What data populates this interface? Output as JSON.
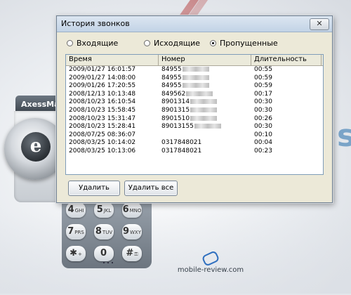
{
  "window": {
    "title": "История звонков",
    "close_label": "✕"
  },
  "filters": [
    {
      "label": "Входящие",
      "checked": false
    },
    {
      "label": "Исходящие",
      "checked": false
    },
    {
      "label": "Пропущенные",
      "checked": true
    }
  ],
  "table": {
    "headers": [
      "Время",
      "Номер",
      "Длительность"
    ],
    "rows": [
      {
        "time": "2009/01/27 16:01:57",
        "number": "84955",
        "masked": true,
        "duration": "00:55"
      },
      {
        "time": "2009/01/27 14:08:00",
        "number": "84955",
        "masked": true,
        "duration": "00:59"
      },
      {
        "time": "2009/01/26 17:20:55",
        "number": "84955",
        "masked": true,
        "duration": "00:59"
      },
      {
        "time": "2008/12/13 10:13:48",
        "number": "849562",
        "masked": true,
        "duration": "00:17"
      },
      {
        "time": "2008/10/23 16:10:54",
        "number": "8901314",
        "masked": true,
        "duration": "00:30"
      },
      {
        "time": "2008/10/23 15:58:45",
        "number": "8901315",
        "masked": true,
        "duration": "00:30"
      },
      {
        "time": "2008/10/23 15:31:47",
        "number": "8901510",
        "masked": true,
        "duration": "00:26"
      },
      {
        "time": "2008/10/23 15:28:41",
        "number": "89013155",
        "masked": true,
        "duration": "00:30"
      },
      {
        "time": "2008/07/25 08:36:07",
        "number": "",
        "masked": false,
        "duration": "00:10"
      },
      {
        "time": "2008/03/25 10:14:02",
        "number": "0317848021",
        "masked": false,
        "duration": "00:04"
      },
      {
        "time": "2008/03/25 10:13:06",
        "number": "0317848021",
        "masked": false,
        "duration": "00:23"
      }
    ]
  },
  "buttons": {
    "delete": "Удалить",
    "delete_all": "Удалить все"
  },
  "device": {
    "title": "AxessMar",
    "logo_letter": "e",
    "keys": [
      {
        "digit": "4",
        "letters": "GHI"
      },
      {
        "digit": "5",
        "letters": "JKL"
      },
      {
        "digit": "6",
        "letters": "MNO"
      },
      {
        "digit": "7",
        "letters": "PRS"
      },
      {
        "digit": "8",
        "letters": "TUV"
      },
      {
        "digit": "9",
        "letters": "WXY"
      },
      {
        "digit": "✱",
        "letters": "+"
      },
      {
        "digit": "0",
        "letters": ""
      },
      {
        "digit": "#",
        "letters": "⚿"
      }
    ]
  },
  "watermark": {
    "text": "mobile-review.com"
  },
  "background": {
    "letter": "s"
  }
}
